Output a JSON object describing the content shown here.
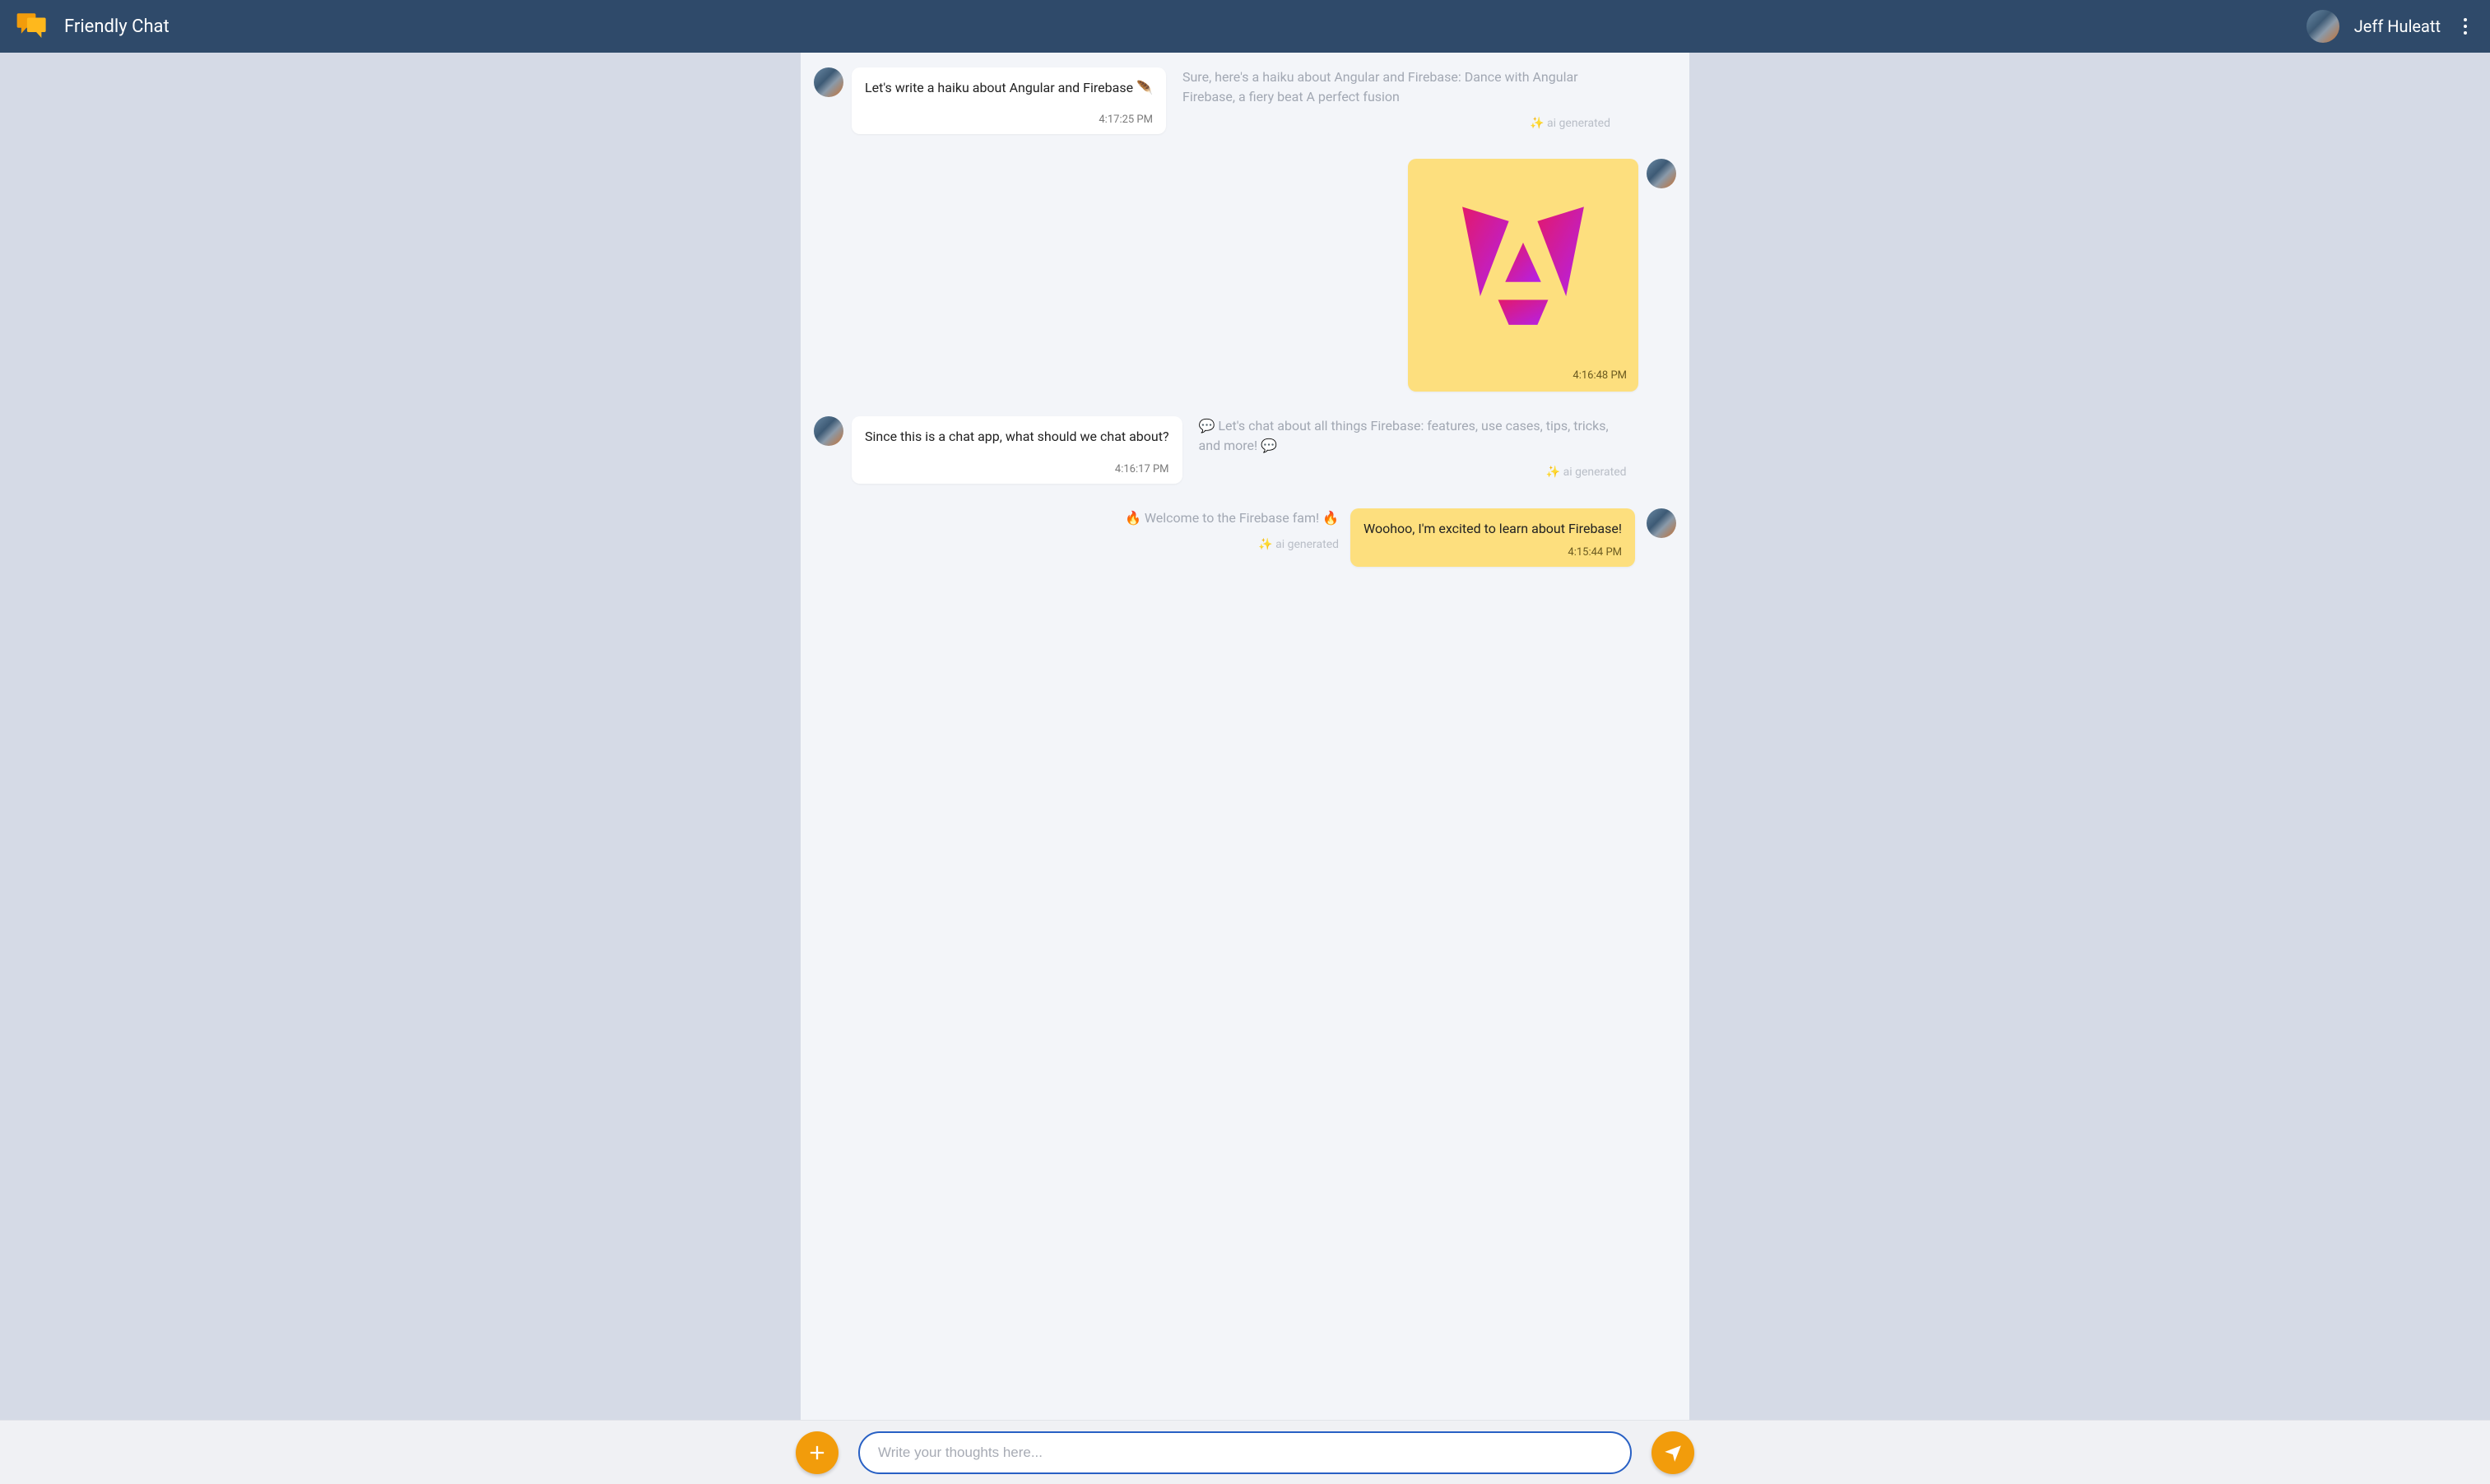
{
  "header": {
    "app_title": "Friendly Chat",
    "username": "Jeff Huleatt"
  },
  "ai_generated_label": "✨ ai generated",
  "messages": [
    {
      "kind": "pair_in_ai",
      "in_text": "Let's write a haiku about Angular and Firebase 🪶",
      "in_time": "4:17:25 PM",
      "ai_text": "Sure, here's a haiku about Angular and Firebase: Dance with Angular Firebase, a fiery beat A perfect fusion"
    },
    {
      "kind": "out_image",
      "time": "4:16:48 PM"
    },
    {
      "kind": "pair_in_ai",
      "in_text": "Since this is a chat app, what should we chat about?",
      "in_time": "4:16:17 PM",
      "ai_text": "💬 Let's chat about all things Firebase: features, use cases, tips, tricks, and more! 💬"
    },
    {
      "kind": "pair_ai_out",
      "ai_text": "🔥 Welcome to the Firebase fam! 🔥",
      "out_text": "Woohoo, I'm excited to learn about Firebase!",
      "out_time": "4:15:44 PM"
    }
  ],
  "composer": {
    "placeholder": "Write your thoughts here..."
  }
}
